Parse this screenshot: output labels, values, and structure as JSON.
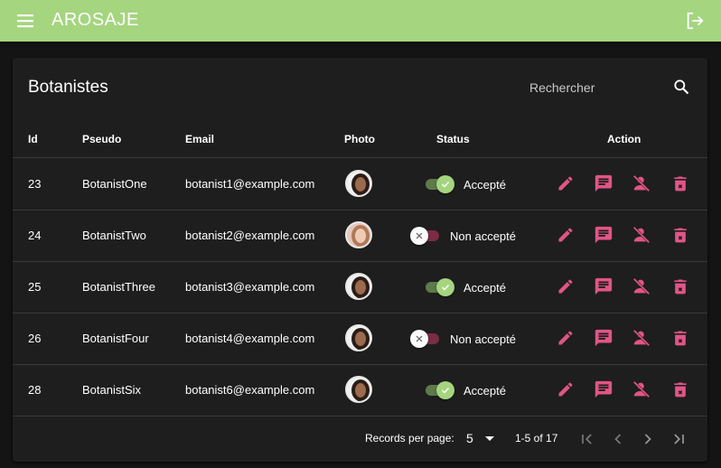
{
  "app": {
    "title": "AROSAJE"
  },
  "colors": {
    "appbar": "#a5d57f",
    "accent": "#e05586",
    "toggle_on": "#a5d57f",
    "toggle_off_track": "#7a2d45"
  },
  "icons": {
    "menu": "menu-icon",
    "logout": "logout-icon",
    "search": "search-icon",
    "edit": "edit-icon",
    "message": "message-icon",
    "remove_user": "person-off-icon",
    "delete": "delete-icon"
  },
  "card": {
    "title": "Botanistes",
    "search": {
      "placeholder": "Rechercher",
      "value": ""
    }
  },
  "table": {
    "headers": {
      "id": "Id",
      "pseudo": "Pseudo",
      "email": "Email",
      "photo": "Photo",
      "status": "Status",
      "action": "Action"
    },
    "rows": [
      {
        "id": "23",
        "pseudo": "BotanistOne",
        "email": "botanist1@example.com",
        "status": "Accepté",
        "accepted": true
      },
      {
        "id": "24",
        "pseudo": "BotanistTwo",
        "email": "botanist2@example.com",
        "status": "Non accepté",
        "accepted": false
      },
      {
        "id": "25",
        "pseudo": "BotanistThree",
        "email": "botanist3@example.com",
        "status": "Accepté",
        "accepted": true
      },
      {
        "id": "26",
        "pseudo": "BotanistFour",
        "email": "botanist4@example.com",
        "status": "Non accepté",
        "accepted": false
      },
      {
        "id": "28",
        "pseudo": "BotanistSix",
        "email": "botanist6@example.com",
        "status": "Accepté",
        "accepted": true
      }
    ]
  },
  "pagination": {
    "records_label": "Records per page:",
    "records_value": "5",
    "range": "1-5 of 17"
  }
}
